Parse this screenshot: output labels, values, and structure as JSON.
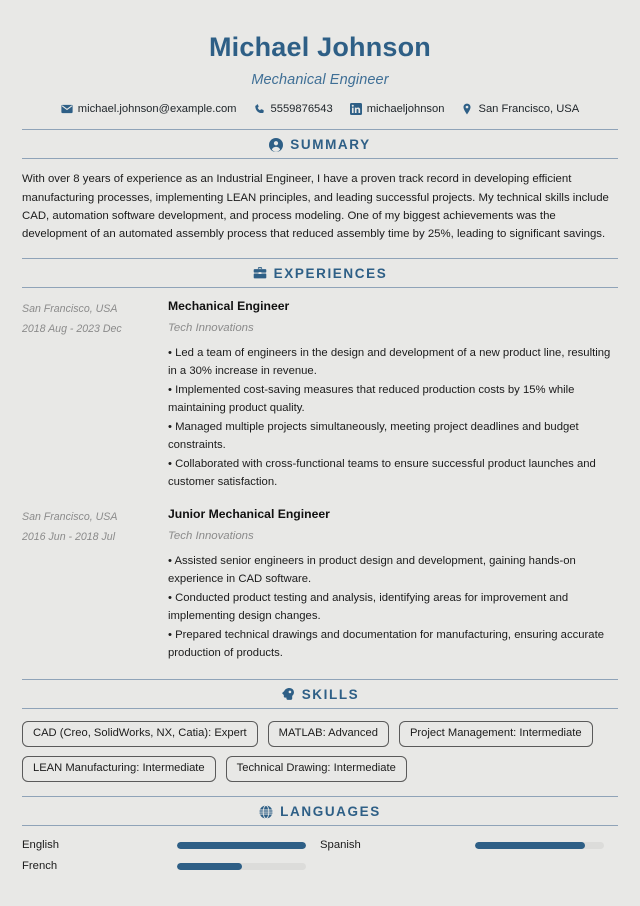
{
  "header": {
    "name": "Michael Johnson",
    "job_title": "Mechanical Engineer",
    "contacts": [
      {
        "icon": "email-icon",
        "text": "michael.johnson@example.com"
      },
      {
        "icon": "phone-icon",
        "text": "5559876543"
      },
      {
        "icon": "linkedin-icon",
        "text": "michaeljohnson"
      },
      {
        "icon": "location-pin-icon",
        "text": "San Francisco, USA"
      }
    ]
  },
  "sections": {
    "summary": {
      "title": "SUMMARY",
      "icon": "person-circle-icon",
      "text": "With over 8 years of experience as an Industrial Engineer, I have a proven track record in developing efficient manufacturing processes, implementing LEAN principles, and leading successful projects. My technical skills include CAD, automation software development, and process modeling. One of my biggest achievements was the development of an automated assembly process that reduced assembly time by 25%, leading to significant savings."
    },
    "experiences": {
      "title": "EXPERIENCES",
      "icon": "briefcase-icon",
      "items": [
        {
          "location": "San Francisco, USA",
          "dates": "2018 Aug - 2023 Dec",
          "role": "Mechanical Engineer",
          "company": "Tech Innovations",
          "bullets": [
            "• Led a team of engineers in the design and development of a new product line, resulting in a 30% increase in revenue.",
            "• Implemented cost-saving measures that reduced production costs by 15% while maintaining product quality.",
            "• Managed multiple projects simultaneously, meeting project deadlines and budget constraints.",
            "• Collaborated with cross-functional teams to ensure successful product launches and customer satisfaction."
          ]
        },
        {
          "location": "San Francisco, USA",
          "dates": "2016 Jun - 2018 Jul",
          "role": "Junior Mechanical Engineer",
          "company": "Tech Innovations",
          "bullets": [
            "• Assisted senior engineers in product design and development, gaining hands-on experience in CAD software.",
            "• Conducted product testing and analysis, identifying areas for improvement and implementing design changes.",
            "• Prepared technical drawings and documentation for manufacturing, ensuring accurate production of products."
          ]
        }
      ]
    },
    "skills": {
      "title": "SKILLS",
      "icon": "head-brain-icon",
      "items": [
        "CAD (Creo, SolidWorks, NX, Catia): Expert",
        "MATLAB: Advanced",
        "Project Management: Intermediate",
        "LEAN Manufacturing: Intermediate",
        "Technical Drawing: Intermediate"
      ]
    },
    "languages": {
      "title": "LANGUAGES",
      "icon": "globe-icon",
      "items": [
        {
          "name": "English",
          "level": 100
        },
        {
          "name": "Spanish",
          "level": 85
        },
        {
          "name": "French",
          "level": 50
        }
      ]
    }
  },
  "colors": {
    "accent": "#2e5f86",
    "divider": "#8fa3b8",
    "background": "#e8e8e6",
    "muted_text": "#8b8b8b"
  }
}
